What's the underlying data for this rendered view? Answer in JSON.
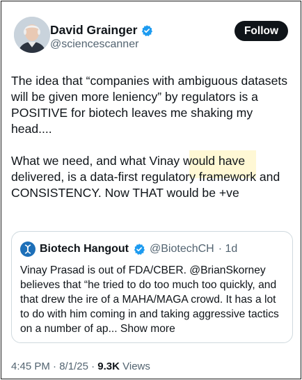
{
  "author": {
    "name": "David Grainger",
    "handle": "@sciencescanner",
    "verified_color": "#1d9bf0"
  },
  "follow_label": "Follow",
  "tweet": {
    "paragraphs": [
      "The idea that “companies with ambiguous datasets will be given more leniency” by regulators is a POSITIVE for biotech leaves me shaking my head....",
      "What we need, and what Vinay would have delivered, is a data-first regulatory framework and CONSISTENCY. Now THAT would be +ve"
    ]
  },
  "quote": {
    "name": "Biotech Hangout",
    "handle": "@BiotechCH",
    "time": "· 1d",
    "text": "Vinay Prasad is out of FDA/CBER. @BrianSkorney believes that “he tried to do too much too quickly, and that drew the ire of a MAHA/MAGA crowd. It has a lot to do with him coming in and taking aggressive tactics on a number of ap...",
    "show_more": "Show more"
  },
  "meta": {
    "time": "4:45 PM",
    "separator1": "·",
    "date": "8/1/25",
    "separator2": "·",
    "views_count": "9.3K",
    "views_label": "Views"
  },
  "colors": {
    "text": "#0f1419",
    "secondary": "#536471",
    "follow_bg": "#0f1419",
    "quote_border": "#cfd9de",
    "highlight": "#fff6c7"
  }
}
